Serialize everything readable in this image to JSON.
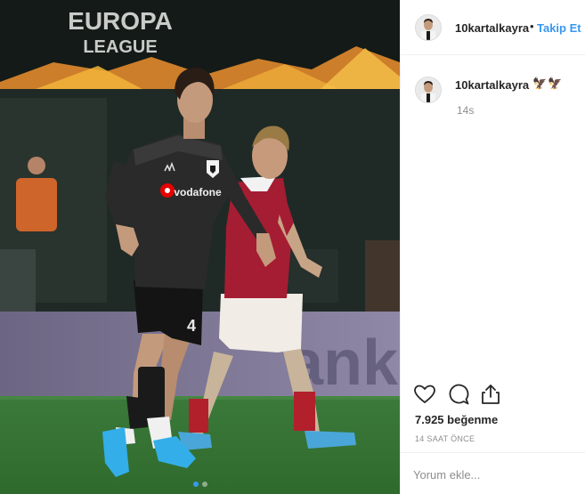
{
  "photo": {
    "banner_line1": "EUROPA",
    "banner_line2": "LEAGUE",
    "sponsor": "vodafone",
    "shirt_number": "4",
    "board_text": "anke",
    "dots_total": 2,
    "dots_active": 1
  },
  "header": {
    "username": "10kartalkayra",
    "separator": "•",
    "follow_label": "Takip Et"
  },
  "caption": {
    "username": "10kartalkayra",
    "emoji": "🦅🦅",
    "time": "14s"
  },
  "actions": {
    "icons": [
      "heart-icon",
      "comment-icon",
      "share-icon"
    ]
  },
  "likes": "7.925 beğenme",
  "posted": "14 SAAT ÖNCE",
  "comment": {
    "placeholder": "Yorum ekle..."
  },
  "colors": {
    "accent": "#3897f0",
    "text": "#262626",
    "muted": "#8e8e8e",
    "border": "#efefef"
  }
}
